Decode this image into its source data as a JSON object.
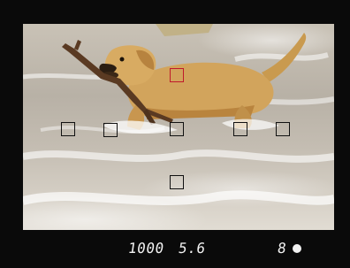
{
  "viewfinder": {
    "readout": {
      "shutter_speed": "1000",
      "aperture": "5.6",
      "frame_count": "8"
    },
    "focus_points": {
      "active_color": "#c0192c",
      "inactive_color": "#111111",
      "active_index": 0,
      "count": 8
    },
    "scene": {
      "subject": "dog-in-water-icon"
    }
  }
}
